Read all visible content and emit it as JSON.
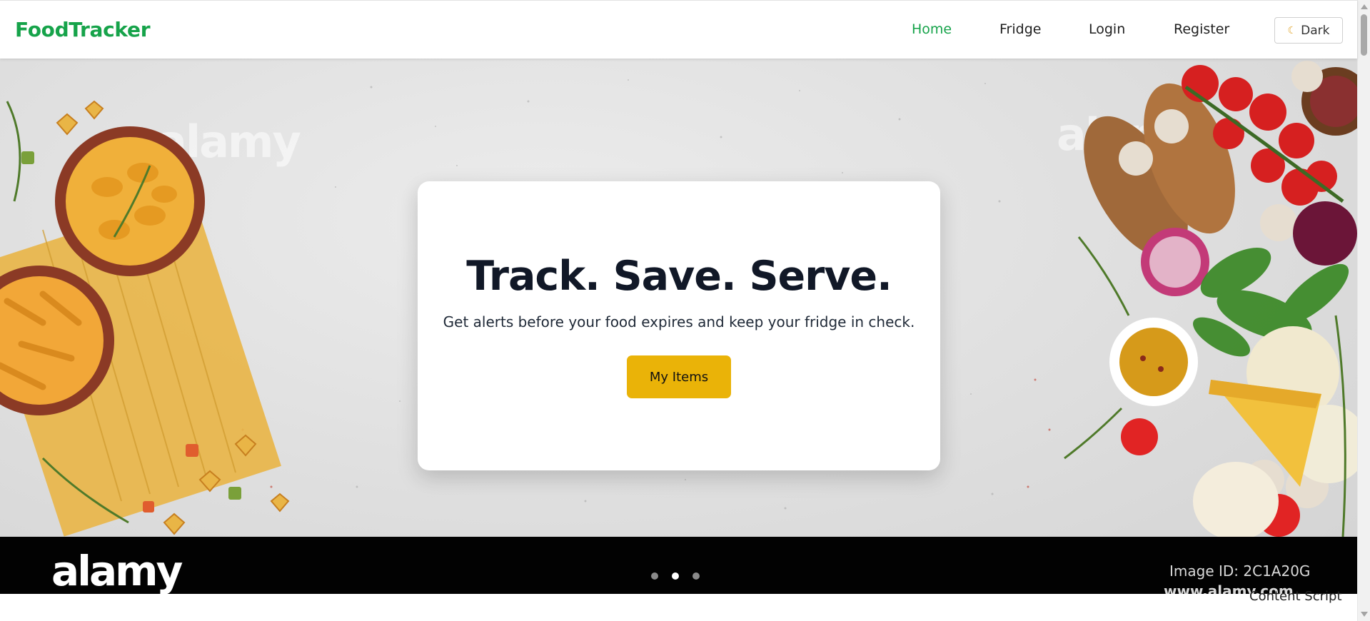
{
  "navbar": {
    "brand": "FoodTracker",
    "links": [
      {
        "label": "Home",
        "active": true
      },
      {
        "label": "Fridge",
        "active": false
      },
      {
        "label": "Login",
        "active": false
      },
      {
        "label": "Register",
        "active": false
      }
    ],
    "theme_toggle": {
      "label": "Dark",
      "icon": "moon-icon"
    }
  },
  "hero": {
    "title": "Track. Save. Serve.",
    "subtitle": "Get alerts before your food expires and keep your fridge in check.",
    "cta_label": "My Items",
    "carousel": {
      "slide_count": 3,
      "active_index": 1
    },
    "photo_watermark": "alamy",
    "photo_band": {
      "logo": "alamy",
      "image_id": "Image ID: 2C1A20G",
      "url": "www.alamy.com"
    }
  },
  "footer": {
    "content_script": "Content Script"
  },
  "colors": {
    "brand_green": "#16a34a",
    "cta_yellow": "#eab308",
    "title_dark": "#111827"
  }
}
